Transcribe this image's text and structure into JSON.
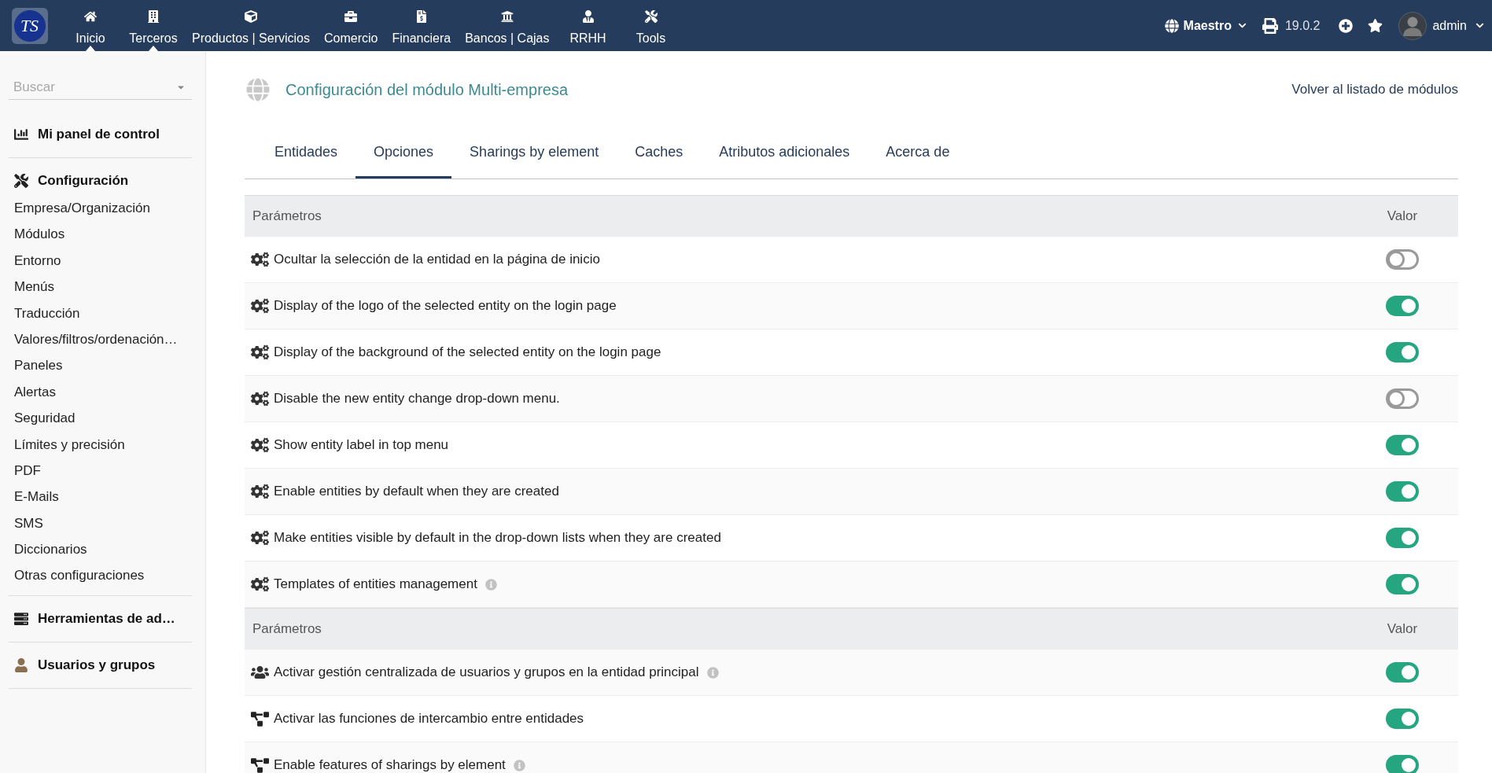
{
  "topbar": {
    "logo": "TS",
    "nav": [
      {
        "label": "Inicio",
        "selected": true
      },
      {
        "label": "Terceros",
        "selected": true
      },
      {
        "label": "Productos | Servicios",
        "selected": false
      },
      {
        "label": "Comercio",
        "selected": false
      },
      {
        "label": "Financiera",
        "selected": false
      },
      {
        "label": "Bancos | Cajas",
        "selected": false
      },
      {
        "label": "RRHH",
        "selected": false
      },
      {
        "label": "Tools",
        "selected": false
      }
    ],
    "entity": "Maestro",
    "version": "19.0.2",
    "user": "admin"
  },
  "sidebar": {
    "search": {
      "placeholder": "Buscar"
    },
    "sections": [
      {
        "title": "Mi panel de control"
      },
      {
        "title": "Configuración",
        "items": [
          "Empresa/Organización",
          "Módulos",
          "Entorno",
          "Menús",
          "Traducción",
          "Valores/filtros/ordenación…",
          "Paneles",
          "Alertas",
          "Seguridad",
          "Límites y precisión",
          "PDF",
          "E-Mails",
          "SMS",
          "Diccionarios",
          "Otras configuraciones"
        ]
      },
      {
        "title": "Herramientas de ad…"
      },
      {
        "title": "Usuarios y grupos"
      }
    ]
  },
  "page": {
    "title": "Configuración del módulo Multi-empresa",
    "back_link": "Volver al listado de módulos"
  },
  "tabs": [
    {
      "label": "Entidades",
      "selected": false
    },
    {
      "label": "Opciones",
      "selected": true
    },
    {
      "label": "Sharings by element",
      "selected": false
    },
    {
      "label": "Caches",
      "selected": false
    },
    {
      "label": "Atributos adicionales",
      "selected": false
    },
    {
      "label": "Acerca de",
      "selected": false
    }
  ],
  "tables": [
    {
      "columns": [
        "Parámetros",
        "Valor"
      ],
      "rows": [
        {
          "label": "Ocultar la selección de la entidad en la página de inicio",
          "info": false,
          "on": false
        },
        {
          "label": "Display of the logo of the selected entity on the login page",
          "info": false,
          "on": true
        },
        {
          "label": "Display of the background of the selected entity on the login page",
          "info": false,
          "on": true
        },
        {
          "label": "Disable the new entity change drop-down menu.",
          "info": false,
          "on": false
        },
        {
          "label": "Show entity label in top menu",
          "info": false,
          "on": true
        },
        {
          "label": "Enable entities by default when they are created",
          "info": false,
          "on": true
        },
        {
          "label": "Make entities visible by default in the drop-down lists when they are created",
          "info": false,
          "on": true
        },
        {
          "label": "Templates of entities management",
          "info": true,
          "on": true
        }
      ]
    },
    {
      "columns": [
        "Parámetros",
        "Valor"
      ],
      "rows": [
        {
          "label": "Activar gestión centralizada de usuarios y grupos en la entidad principal",
          "info": true,
          "on": true
        },
        {
          "label": "Activar las funciones de intercambio entre entidades",
          "info": false,
          "on": true
        },
        {
          "label": "Enable features of sharings by element",
          "info": true,
          "on": true
        }
      ]
    }
  ]
}
